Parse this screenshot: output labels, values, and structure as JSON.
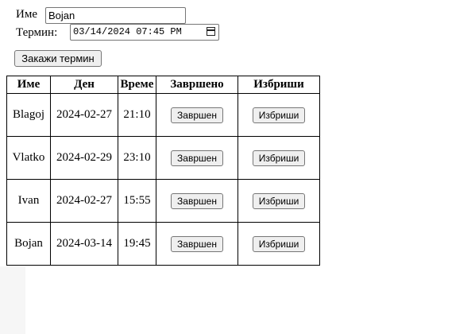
{
  "form": {
    "name_label": "Име",
    "name_value": "Bojan",
    "term_label": "Термин:",
    "term_value": "03/14/2024 07:45 PM",
    "calendar_icon": "calendar-icon",
    "submit_label": "Закажи термин"
  },
  "table": {
    "headers": [
      "Име",
      "Ден",
      "Време",
      "Завршено",
      "Избриши"
    ],
    "rows": [
      {
        "name": "Blagoj",
        "day": "2024-02-27",
        "time": "21:10",
        "done_label": "Завршен",
        "delete_label": "Избриши"
      },
      {
        "name": "Vlatko",
        "day": "2024-02-29",
        "time": "23:10",
        "done_label": "Завршен",
        "delete_label": "Избриши"
      },
      {
        "name": "Ivan",
        "day": "2024-02-27",
        "time": "15:55",
        "done_label": "Завршен",
        "delete_label": "Избриши"
      },
      {
        "name": "Bojan",
        "day": "2024-03-14",
        "time": "19:45",
        "done_label": "Завршен",
        "delete_label": "Избриши"
      }
    ]
  }
}
